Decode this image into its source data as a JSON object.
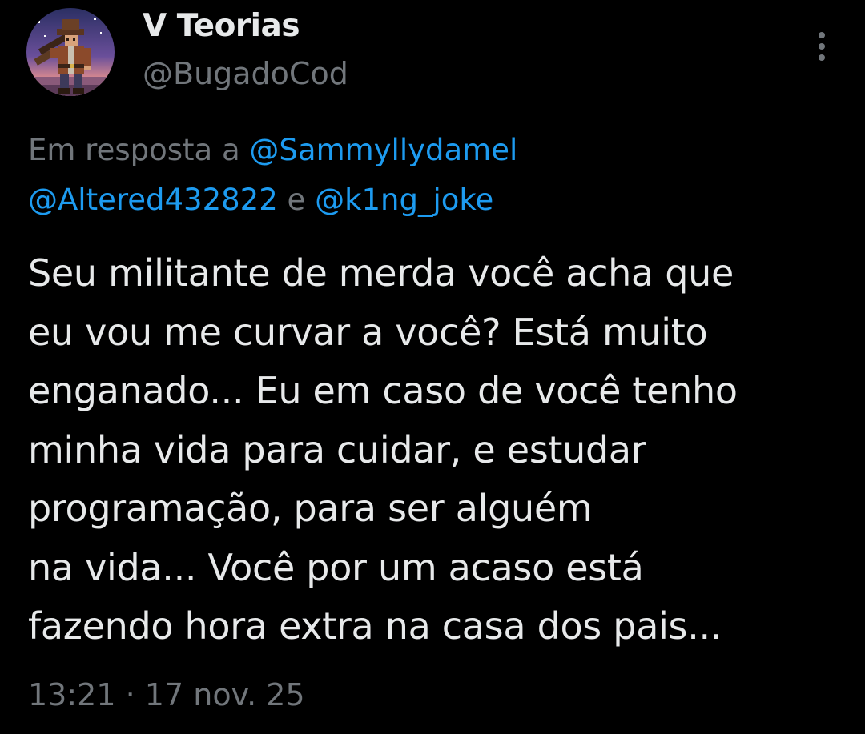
{
  "author": {
    "display_name": "V Teorias",
    "handle": "@BugadoCod",
    "avatar_icon": "pixel-art-cowboy-avatar"
  },
  "menu": {
    "icon": "more-vertical-icon"
  },
  "reply": {
    "prefix": "Em resposta a",
    "mentions": [
      "@Sammyllydamel",
      "@Altered432822",
      "@k1ng_joke"
    ],
    "conjunction": "e"
  },
  "tweet": {
    "lines": [
      "Seu militante de merda você acha que",
      "eu vou me curvar a você? Está muito",
      "enganado... Eu em caso de você tenho",
      "minha vida para cuidar, e estudar",
      "programação, para ser alguém",
      "na vida... Você por um acaso está",
      "fazendo hora extra na casa dos pais..."
    ]
  },
  "meta": {
    "time": "13:21",
    "separator": "·",
    "date": "17 nov. 25"
  },
  "colors": {
    "background": "#000000",
    "primary_text": "#e7e9ea",
    "secondary_text": "#71767b",
    "link": "#1d9bf0"
  }
}
